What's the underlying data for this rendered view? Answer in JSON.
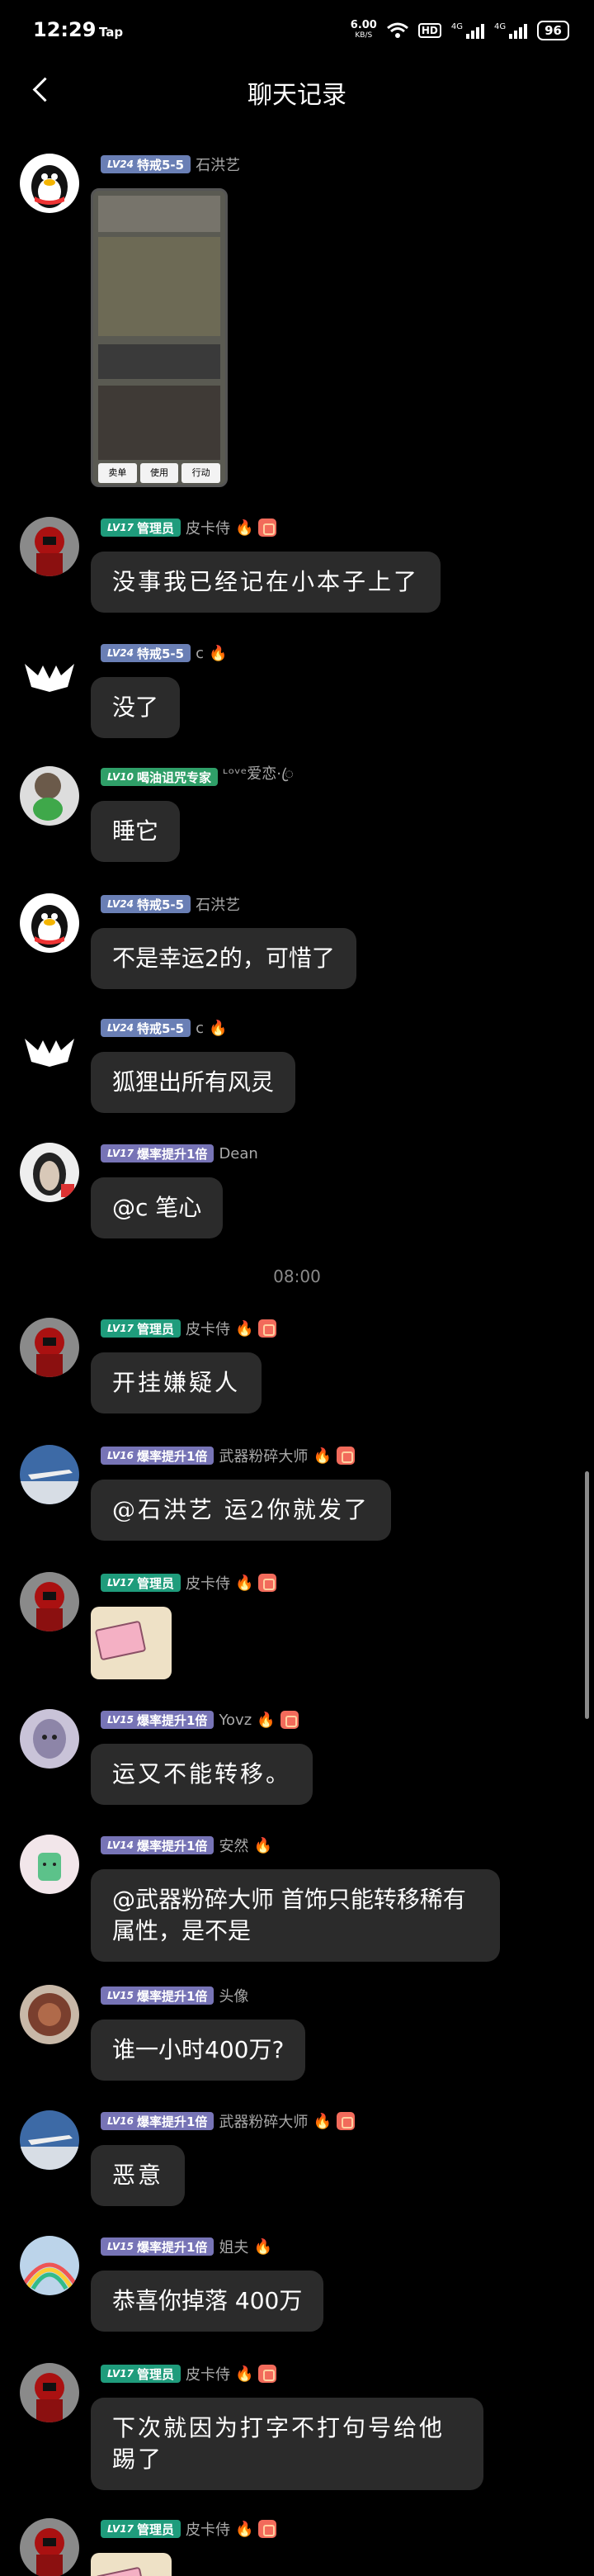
{
  "status": {
    "time": "12:29",
    "carrier": "Tap",
    "speed": "6.00",
    "speed_unit": "KB/S",
    "hd": "HD",
    "sig1": "4G",
    "sig2": "4G",
    "battery": "96"
  },
  "header": {
    "title": "聊天记录"
  },
  "timestamp": "08:00",
  "messages": [
    {
      "level": "LV24",
      "badge": "特戒5-5",
      "nick": "石洪艺",
      "avatar": "qq-penguin",
      "type": "image"
    },
    {
      "level": "LV17",
      "badge": "管理员",
      "nick": "皮卡侍",
      "avatar": "red-hood",
      "text": "没事我已经记在小本子上了"
    },
    {
      "level": "LV24",
      "badge": "特戒5-5",
      "nick": "c",
      "avatar": "white-bat",
      "text": "没了"
    },
    {
      "level": "LV10",
      "badge": "喝油诅咒专家",
      "nick": "ᶫᵒᵛᵉ爱恋·ꦿ",
      "avatar": "skull-frog",
      "text": "睡它"
    },
    {
      "level": "LV24",
      "badge": "特戒5-5",
      "nick": "石洪艺",
      "avatar": "qq-penguin",
      "text": "不是幸运2的，可惜了"
    },
    {
      "level": "LV24",
      "badge": "特戒5-5",
      "nick": "c",
      "avatar": "white-bat",
      "text": "狐狸出所有风灵"
    },
    {
      "level": "LV17",
      "badge": "爆率提升1倍",
      "nick": "Dean",
      "avatar": "face",
      "text": "@c 笔心"
    },
    {
      "level": "LV17",
      "badge": "管理员",
      "nick": "皮卡侍",
      "avatar": "red-hood",
      "text": "开挂嫌疑人"
    },
    {
      "level": "LV16",
      "badge": "爆率提升1倍",
      "nick": "武器粉碎大师",
      "avatar": "plane",
      "text": "@石洪艺 运2你就发了"
    },
    {
      "level": "LV17",
      "badge": "管理员",
      "nick": "皮卡侍",
      "avatar": "red-hood",
      "type": "sticker"
    },
    {
      "level": "LV15",
      "badge": "爆率提升1倍",
      "nick": "Yovz",
      "avatar": "anime",
      "text": "运又不能转移。"
    },
    {
      "level": "LV14",
      "badge": "爆率提升1倍",
      "nick": "安然",
      "avatar": "cartoon",
      "text": "@武器粉碎大师 首饰只能转移稀有属性，是不是"
    },
    {
      "level": "LV15",
      "badge": "爆率提升1倍",
      "nick": "头像",
      "avatar": "tattoo",
      "text": "谁一小时400万?"
    },
    {
      "level": "LV16",
      "badge": "爆率提升1倍",
      "nick": "武器粉碎大师",
      "avatar": "plane",
      "text": "恶意"
    },
    {
      "level": "LV15",
      "badge": "爆率提升1倍",
      "nick": "姐夫",
      "avatar": "rainbow",
      "text": "恭喜你掉落   400万"
    },
    {
      "level": "LV17",
      "badge": "管理员",
      "nick": "皮卡侍",
      "avatar": "red-hood",
      "text": "下次就因为打字不打句号给他踢了"
    },
    {
      "level": "LV17",
      "badge": "管理员",
      "nick": "皮卡侍",
      "avatar": "red-hood",
      "type": "sticker"
    }
  ],
  "image_buttons": [
    "卖单",
    "使用",
    "行动"
  ],
  "colors": {
    "admin": "#1f9c7c",
    "special": "#6a7fb5",
    "drop": "#7774b6",
    "oil": "#2f9f68",
    "bubble": "#2b2b2b"
  }
}
